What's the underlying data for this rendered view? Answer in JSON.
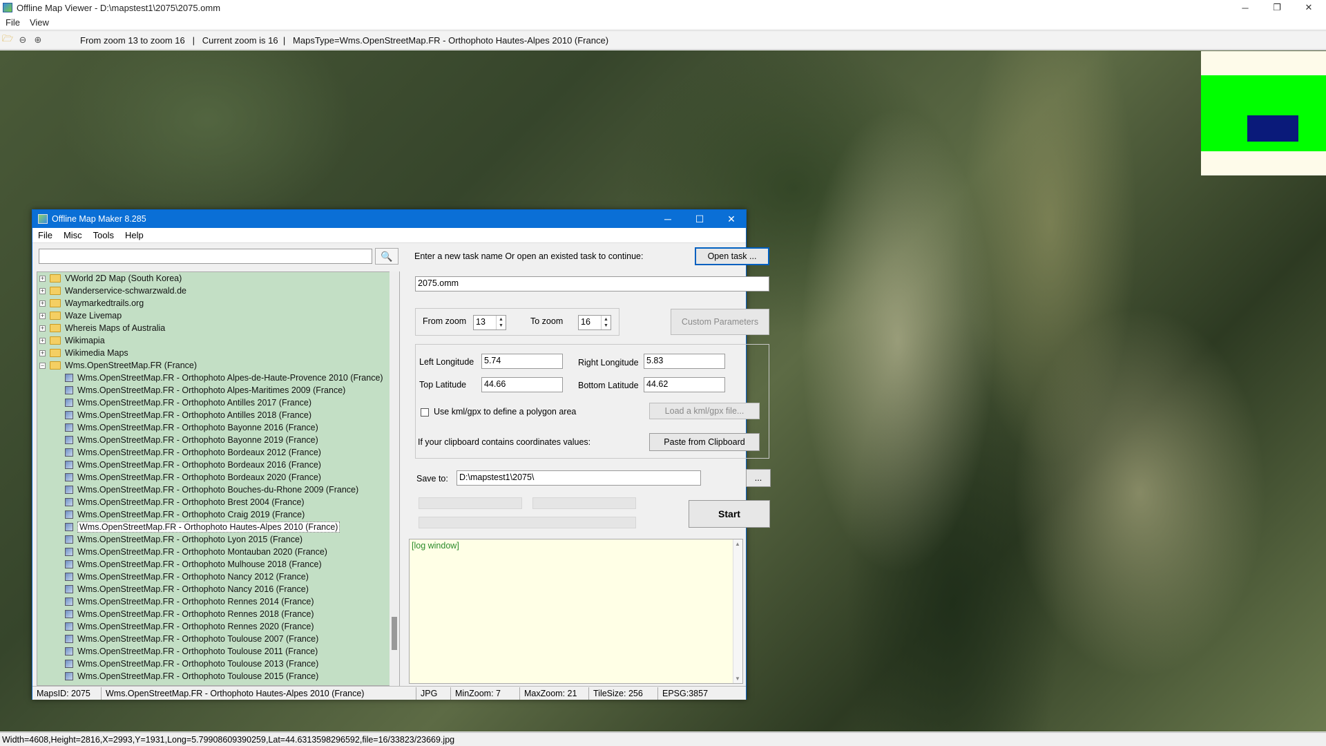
{
  "window": {
    "title": "Offline Map Viewer - D:\\mapstest1\\2075\\2075.omm",
    "menu": [
      "File",
      "View"
    ],
    "controls": {
      "minimize": "─",
      "maximize": "❐",
      "close": "✕"
    }
  },
  "toolbar": {
    "info": "From zoom 13 to zoom 16   |   Current zoom is 16  |   MapsType=Wms.OpenStreetMap.FR - Orthophoto Hautes-Alpes 2010 (France)"
  },
  "minimap_colors": {
    "bg": "#fefbea",
    "zone": "#00ff00",
    "view": "#0a1a7a"
  },
  "dialog": {
    "title": "Offline Map Maker 8.285",
    "menu": [
      "File",
      "Misc",
      "Tools",
      "Help"
    ],
    "controls": {
      "minimize": "─",
      "maximize": "☐",
      "close": "✕"
    },
    "search": {
      "placeholder": "",
      "icon": "🔍"
    },
    "tree": {
      "folders": [
        {
          "label": "VWorld 2D Map (South Korea)",
          "expander": "+"
        },
        {
          "label": "Wanderservice-schwarzwald.de",
          "expander": "+"
        },
        {
          "label": "Waymarkedtrails.org",
          "expander": "+"
        },
        {
          "label": "Waze Livemap",
          "expander": "+"
        },
        {
          "label": "Whereis Maps of Australia",
          "expander": "+"
        },
        {
          "label": "Wikimapia",
          "expander": "+"
        },
        {
          "label": "Wikimedia Maps",
          "expander": "+"
        },
        {
          "label": "Wms.OpenStreetMap.FR (France)",
          "expander": "−"
        }
      ],
      "children": [
        "Wms.OpenStreetMap.FR - Orthophoto Alpes-de-Haute-Provence 2010 (France)",
        "Wms.OpenStreetMap.FR - Orthophoto Alpes-Maritimes 2009 (France)",
        "Wms.OpenStreetMap.FR - Orthophoto Antilles 2017 (France)",
        "Wms.OpenStreetMap.FR - Orthophoto Antilles 2018 (France)",
        "Wms.OpenStreetMap.FR - Orthophoto Bayonne 2016 (France)",
        "Wms.OpenStreetMap.FR - Orthophoto Bayonne 2019 (France)",
        "Wms.OpenStreetMap.FR - Orthophoto Bordeaux 2012 (France)",
        "Wms.OpenStreetMap.FR - Orthophoto Bordeaux 2016 (France)",
        "Wms.OpenStreetMap.FR - Orthophoto Bordeaux 2020 (France)",
        "Wms.OpenStreetMap.FR - Orthophoto Bouches-du-Rhone 2009 (France)",
        "Wms.OpenStreetMap.FR - Orthophoto Brest 2004 (France)",
        "Wms.OpenStreetMap.FR - Orthophoto Craig 2019 (France)",
        "Wms.OpenStreetMap.FR - Orthophoto Hautes-Alpes 2010 (France)",
        "Wms.OpenStreetMap.FR - Orthophoto Lyon 2015 (France)",
        "Wms.OpenStreetMap.FR - Orthophoto Montauban 2020 (France)",
        "Wms.OpenStreetMap.FR - Orthophoto Mulhouse 2018 (France)",
        "Wms.OpenStreetMap.FR - Orthophoto Nancy 2012 (France)",
        "Wms.OpenStreetMap.FR - Orthophoto Nancy 2016 (France)",
        "Wms.OpenStreetMap.FR - Orthophoto Rennes 2014 (France)",
        "Wms.OpenStreetMap.FR - Orthophoto Rennes 2018 (France)",
        "Wms.OpenStreetMap.FR - Orthophoto Rennes 2020 (France)",
        "Wms.OpenStreetMap.FR - Orthophoto Toulouse 2007 (France)",
        "Wms.OpenStreetMap.FR - Orthophoto Toulouse 2011 (France)",
        "Wms.OpenStreetMap.FR - Orthophoto Toulouse 2013 (France)",
        "Wms.OpenStreetMap.FR - Orthophoto Toulouse 2015 (France)"
      ],
      "selected_index": 12
    },
    "task": {
      "prompt": "Enter a new task name Or open an existed task to continue:",
      "open_button": "Open task ...",
      "name": "2075.omm"
    },
    "zoom": {
      "from_label": "From zoom",
      "from_value": "13",
      "to_label": "To zoom",
      "to_value": "16",
      "custom_button": "Custom Parameters"
    },
    "coords": {
      "left_lon_label": "Left Longitude",
      "left_lon": "5.74",
      "right_lon_label": "Right Longitude",
      "right_lon": "5.83",
      "top_lat_label": "Top Latitude",
      "top_lat": "44.66",
      "bottom_lat_label": "Bottom Latitude",
      "bottom_lat": "44.62",
      "kml_checkbox": "Use kml/gpx to define a polygon area",
      "kml_button": "Load a kml/gpx file...",
      "clipboard_label": "If your clipboard contains coordinates values:",
      "clipboard_button": "Paste from Clipboard"
    },
    "save": {
      "label": "Save to:",
      "path": "D:\\mapstest1\\2075\\",
      "browse": "...",
      "start": "Start"
    },
    "log": {
      "text": "[log window]",
      "up": "▲",
      "down": "▼"
    },
    "status": {
      "maps_id": "MapsID: 2075",
      "map_name": "Wms.OpenStreetMap.FR - Orthophoto Hautes-Alpes 2010 (France)",
      "format": "JPG",
      "min_zoom": "MinZoom: 7",
      "max_zoom": "MaxZoom: 21",
      "tile_size": "TileSize: 256",
      "epsg": "EPSG:3857"
    }
  },
  "statusbar": {
    "text": "Width=4608,Height=2816,X=2993,Y=1931,Long=5.79908609390259,Lat=44.6313598296592,file=16/33823/23669.jpg"
  }
}
